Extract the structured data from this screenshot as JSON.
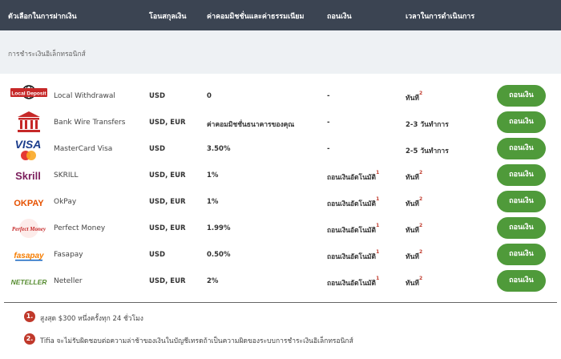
{
  "header": {
    "col_method": "ตัวเลือกในการฝากเงิน",
    "col_currency": "โอนสกุลเงิน",
    "col_fee": "ค่าคอมมิชชั่นและค่าธรรมเนียม",
    "col_withdraw": "ถอนเงิน",
    "col_time": "เวลาในการดำเนินการ"
  },
  "section": {
    "title": "การชำระเงินอิเล็กทรอนิกส์"
  },
  "rows": [
    {
      "name": "Local Withdrawal",
      "logo_text": "Local Deposit",
      "currency": "USD",
      "fee": "0",
      "withdraw": "-",
      "withdraw_sup": "",
      "time": "ทันที",
      "time_sup": "2",
      "button": "ถอนเงิน"
    },
    {
      "name": "Bank Wire Transfers",
      "logo_text": "",
      "currency": "USD, EUR",
      "fee": "ค่าคอมมิชชั่นธนาคารของคุณ",
      "withdraw": "-",
      "withdraw_sup": "",
      "time": "2-3 วันทำการ",
      "time_sup": "",
      "button": "ถอนเงิน"
    },
    {
      "name": "MasterCard Visa",
      "logo_text": "VISA",
      "currency": "USD",
      "fee": "3.50%",
      "withdraw": "-",
      "withdraw_sup": "",
      "time": "2-5 วันทำการ",
      "time_sup": "",
      "button": "ถอนเงิน"
    },
    {
      "name": "SKRILL",
      "logo_text": "Skrill",
      "currency": "USD, EUR",
      "fee": "1%",
      "withdraw": "ถอนเงินอัตโนมัติ",
      "withdraw_sup": "1",
      "time": "ทันที",
      "time_sup": "2",
      "button": "ถอนเงิน"
    },
    {
      "name": "OkPay",
      "logo_text": "OKPAY",
      "currency": "USD, EUR",
      "fee": "1%",
      "withdraw": "ถอนเงินอัตโนมัติ",
      "withdraw_sup": "1",
      "time": "ทันที",
      "time_sup": "2",
      "button": "ถอนเงิน"
    },
    {
      "name": "Perfect Money",
      "logo_text": "Perfect Money",
      "currency": "USD, EUR",
      "fee": "1.99%",
      "withdraw": "ถอนเงินอัตโนมัติ",
      "withdraw_sup": "1",
      "time": "ทันที",
      "time_sup": "2",
      "button": "ถอนเงิน"
    },
    {
      "name": "Fasapay",
      "logo_text": "fasapay",
      "currency": "USD",
      "fee": "0.50%",
      "withdraw": "ถอนเงินอัตโนมัติ",
      "withdraw_sup": "1",
      "time": "ทันที",
      "time_sup": "2",
      "button": "ถอนเงิน"
    },
    {
      "name": "Neteller",
      "logo_text": "NETELLER",
      "currency": "USD, EUR",
      "fee": "2%",
      "withdraw": "ถอนเงินอัตโนมัติ",
      "withdraw_sup": "1",
      "time": "ทันที",
      "time_sup": "2",
      "button": "ถอนเงิน"
    }
  ],
  "notes": [
    {
      "num": "1.",
      "text": "สูงสุด $300 หนึ่งครั้งทุก 24 ชั่วโมง"
    },
    {
      "num": "2.",
      "text": "Tifia จะไม่รับผิดชอบต่อความล่าช้าของเงินในบัญชีเทรดถ้าเป็นความผิดของระบบการชำระเงินอิเล็กทรอนิกส์"
    }
  ],
  "colors": {
    "header_bg": "#3b4452",
    "section_bg": "#eef1f4",
    "button_bg": "#4f9a3a",
    "accent_red": "#c0392b"
  }
}
